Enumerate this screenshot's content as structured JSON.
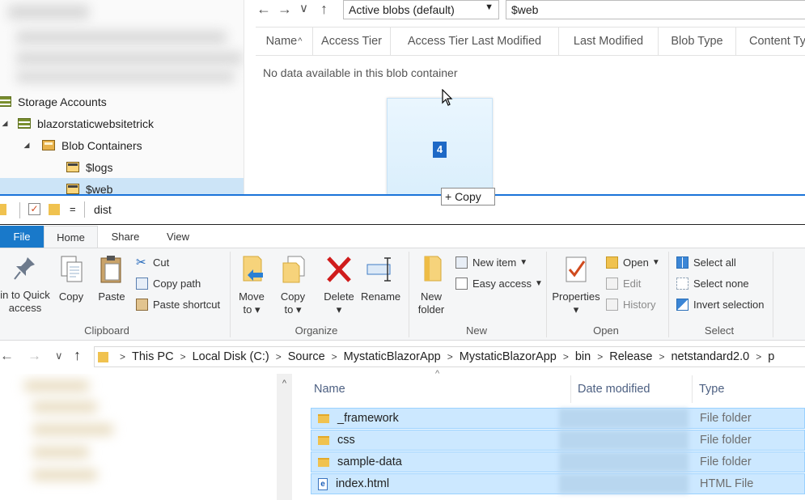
{
  "storage_explorer": {
    "tree": {
      "storage_accounts": "Storage Accounts",
      "account_name": "blazorstaticwebsitetrick",
      "blob_containers": "Blob Containers",
      "containers": [
        "$logs",
        "$web"
      ],
      "selected": "$web"
    },
    "toolbar": {
      "back_icon": "←",
      "forward_icon": "→",
      "dropdown_icon": "∨",
      "up_icon": "↑",
      "view_select": "Active blobs (default)",
      "select_caret": "▼",
      "path_value": "$web"
    },
    "grid": {
      "columns": [
        "Name",
        "Access Tier",
        "Access Tier Last Modified",
        "Last Modified",
        "Blob Type",
        "Content Ty"
      ],
      "sort_indicator": "^",
      "empty_message": "No data available in this blob container"
    },
    "drag": {
      "count": "4",
      "copy_label": "+ Copy"
    }
  },
  "file_explorer": {
    "qat": {
      "dropdown": "=",
      "title": "dist"
    },
    "ribbon_tabs": [
      "File",
      "Home",
      "Share",
      "View"
    ],
    "active_tab": "Home",
    "clipboard": {
      "pin_label_1": "in to Quick",
      "pin_label_2": "access",
      "copy": "Copy",
      "paste": "Paste",
      "cut": "Cut",
      "copy_path": "Copy path",
      "paste_shortcut": "Paste shortcut",
      "group": "Clipboard"
    },
    "organize": {
      "move_1": "Move",
      "move_2": "to",
      "copy_1": "Copy",
      "copy_2": "to",
      "delete": "Delete",
      "rename": "Rename",
      "group": "Organize",
      "drop_caret": "▾"
    },
    "new": {
      "new_folder_1": "New",
      "new_folder_2": "folder",
      "new_item": "New item",
      "easy_access": "Easy access",
      "group": "New"
    },
    "open": {
      "properties": "Properties",
      "open": "Open",
      "edit": "Edit",
      "history": "History",
      "group": "Open"
    },
    "select": {
      "select_all": "Select all",
      "select_none": "Select none",
      "invert": "Invert selection",
      "group": "Select"
    },
    "address": {
      "back": "←",
      "forward": "→",
      "recent": "∨",
      "up": "↑",
      "crumbs": [
        "This PC",
        "Local Disk (C:)",
        "Source",
        "MystaticBlazorApp",
        "MystaticBlazorApp",
        "bin",
        "Release",
        "netstandard2.0",
        "p"
      ],
      "separator": ">"
    },
    "list": {
      "columns": [
        "Name",
        "Date modified",
        "Type"
      ],
      "sort_indicator": "^",
      "scroll_up": "^",
      "rows": [
        {
          "name": "_framework",
          "type": "File folder",
          "kind": "folder"
        },
        {
          "name": "css",
          "type": "File folder",
          "kind": "folder"
        },
        {
          "name": "sample-data",
          "type": "File folder",
          "kind": "folder"
        },
        {
          "name": "index.html",
          "type": "HTML File",
          "kind": "html"
        }
      ]
    }
  }
}
